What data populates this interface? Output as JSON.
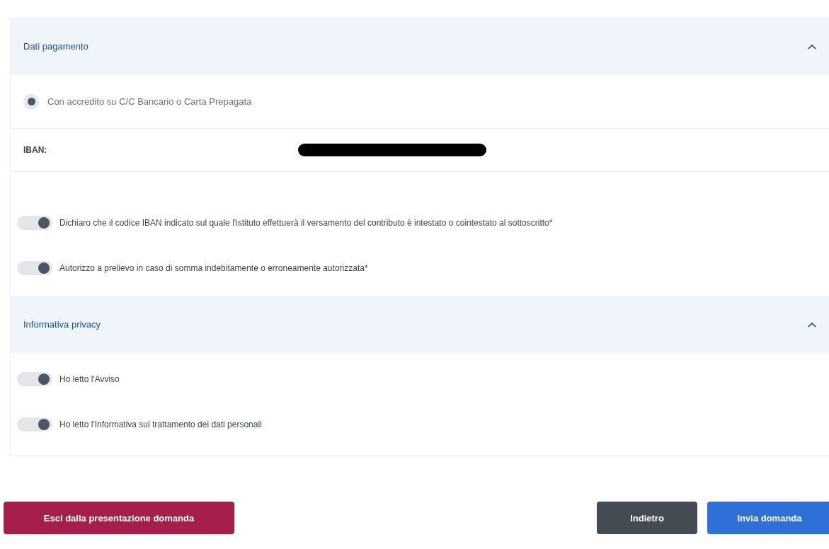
{
  "sections": [
    {
      "title": "Dati pagamento",
      "expanded": true,
      "items": [
        {
          "kind": "radio",
          "label": "Con accredito su C/C Bancario o Carta Prepagata",
          "selected": true
        },
        {
          "kind": "field",
          "label": "IBAN:",
          "redacted": true
        },
        {
          "kind": "toggle",
          "label": "Dichiaro che il codice IBAN indicato sul quale l'istituto effettuerà il versamento del contributo è intestato o cointestato al sottoscritto*",
          "checked": true
        },
        {
          "kind": "toggle",
          "label": "Autorizzo a prelievo in caso di somma indebitamente o erroneamente autorizzata*",
          "checked": true
        }
      ]
    },
    {
      "title": "Informativa privacy",
      "expanded": true,
      "items": [
        {
          "kind": "toggle",
          "label": "Ho letto l'Avviso",
          "checked": true
        },
        {
          "kind": "toggle",
          "label": "Ho letto l'Informativa sul trattamento dei dati personali",
          "checked": true
        }
      ]
    }
  ],
  "buttons": [
    {
      "kind": "danger",
      "label": "Esci dalla presentazione domanda"
    },
    {
      "kind": "secondary",
      "label": "Indietro"
    },
    {
      "kind": "primary",
      "label": "Invia domanda"
    }
  ]
}
